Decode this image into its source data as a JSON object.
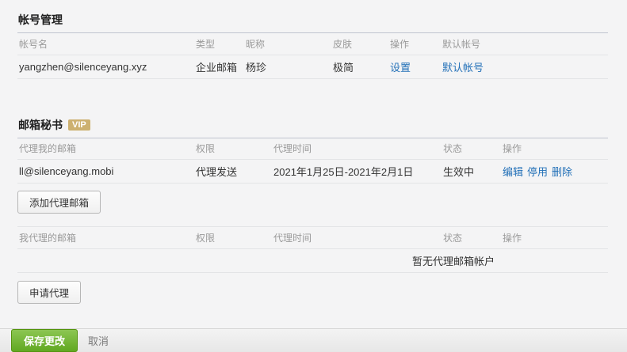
{
  "colors": {
    "page_bg": "#f4f4f5",
    "link": "#2471b8",
    "vip_badge_bg": "#cdb170",
    "save_button_green": "#61a821"
  },
  "account_section": {
    "title": "帐号管理",
    "columns": [
      "帐号名",
      "类型",
      "昵称",
      "皮肤",
      "操作",
      "默认帐号"
    ],
    "row": {
      "account": "yangzhen@silenceyang.xyz",
      "type": "企业邮箱",
      "nickname": "杨珍",
      "skin": "极简",
      "settings_link": "设置",
      "default_link": "默认帐号"
    }
  },
  "secretary_section": {
    "title": "邮箱秘书",
    "vip_badge": "VIP",
    "delegated_to_me": {
      "columns": [
        "代理我的邮箱",
        "权限",
        "代理时间",
        "状态",
        "操作"
      ],
      "row": {
        "mailbox": "ll@silenceyang.mobi",
        "permission": "代理发送",
        "period": "2021年1月25日-2021年2月1日",
        "status": "生效中",
        "actions": [
          "编辑",
          "停用",
          "删除"
        ]
      },
      "add_button": "添加代理邮箱"
    },
    "delegated_by_me": {
      "columns": [
        "我代理的邮箱",
        "权限",
        "代理时间",
        "状态",
        "操作"
      ],
      "empty_text": "暂无代理邮箱帐户",
      "apply_button": "申请代理"
    }
  },
  "footer": {
    "save_label": "保存更改",
    "cancel_label": "取消"
  }
}
